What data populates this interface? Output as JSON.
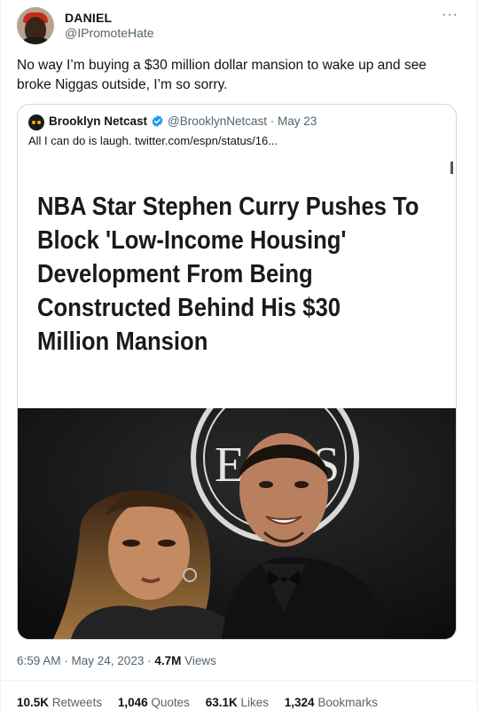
{
  "author": {
    "display_name": "DANIEL",
    "handle": "@IPromoteHate"
  },
  "more_glyph": "···",
  "tweet_text": "No way I’m buying a $30 million dollar mansion to wake up and see broke Niggas outside, I’m so sorry.",
  "quoted_tweet": {
    "display_name": "Brooklyn Netcast",
    "meta": "@BrooklynNetcast · May 23",
    "text": "All I can do is laugh.  twitter.com/espn/status/16...",
    "article_headline": [
      "NBA Star Stephen Curry Pushes To",
      "Block 'Low-Income Housing'",
      "Development From Being",
      "Constructed Behind His $30",
      "Million Mansion"
    ],
    "photo_logo_letters": [
      "E",
      "S"
    ]
  },
  "timestamp": {
    "time": "6:59 AM · May 24, 2023 · ",
    "views_count": "4.7M",
    "views_label": "Views"
  },
  "stats": [
    {
      "count": "10.5K",
      "label": "Retweets"
    },
    {
      "count": "1,046",
      "label": "Quotes"
    },
    {
      "count": "63.1K",
      "label": "Likes"
    },
    {
      "count": "1,324",
      "label": "Bookmarks"
    }
  ],
  "colors": {
    "text": "#0f1419",
    "secondary": "#536471",
    "border": "#cfd9de",
    "verified": "#1d9bf0"
  }
}
